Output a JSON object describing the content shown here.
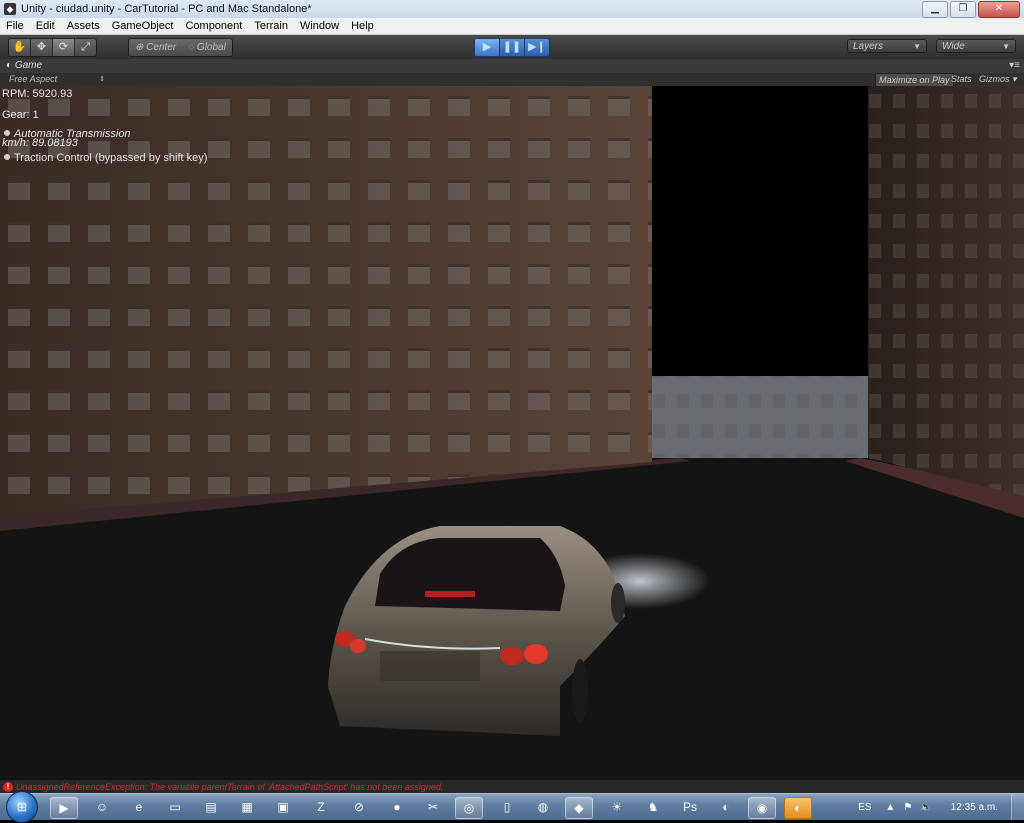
{
  "window": {
    "title": "Unity - ciudad.unity - CarTutorial - PC and Mac Standalone*",
    "controls": [
      "minimize",
      "restore",
      "close"
    ]
  },
  "menu": {
    "items": [
      "File",
      "Edit",
      "Assets",
      "GameObject",
      "Component",
      "Terrain",
      "Window",
      "Help"
    ]
  },
  "toolbar": {
    "transform_tools": [
      "hand-icon",
      "move-icon",
      "rotate-icon",
      "scale-icon"
    ],
    "active_tool": "rotate-icon",
    "pivot_mode": "Center",
    "pivot_rotation": "Global",
    "play_controls": [
      "play-icon",
      "pause-icon",
      "step-icon"
    ],
    "playing": true,
    "layers_label": "Layers",
    "layout_label": "Wide"
  },
  "game_view": {
    "tab_label": "Game",
    "aspect_label": "Free Aspect",
    "maximize_label": "Maximize on Play",
    "stats_label": "Stats",
    "gizmos_label": "Gizmos"
  },
  "hud": {
    "rpm": "RPM: 5920.93",
    "gear": "Gear: 1",
    "automatic": "Automatic Transmission",
    "kmh": "km/h: 89.08193",
    "traction": "Traction Control (bypassed by shift key)"
  },
  "status": {
    "error_text": "UnassignedReferenceException: The variable parentTerrain of 'AttachedPathScript' has not been assigned.",
    "error_color": "#c03030"
  },
  "taskbar": {
    "language": "ES",
    "clock": "12:35 a.m.",
    "apps": [
      "media-player-icon",
      "user-icon",
      "ie-icon",
      "folder-icon",
      "folder-open-icon",
      "photo-icon",
      "zip-icon",
      "no-icon",
      "record-icon",
      "tools-icon",
      "screenshot-icon",
      "phone-icon",
      "globe-icon",
      "unity-icon",
      "sun-icon",
      "gimp-icon",
      "photoshop-icon",
      "firefox-icon",
      "network-icon",
      "firefox-active-icon"
    ]
  },
  "colors": {
    "toolbar_bg": "#3c3c3c",
    "play_active": "#3b76c8",
    "hud_text": "#e6e6e6"
  }
}
